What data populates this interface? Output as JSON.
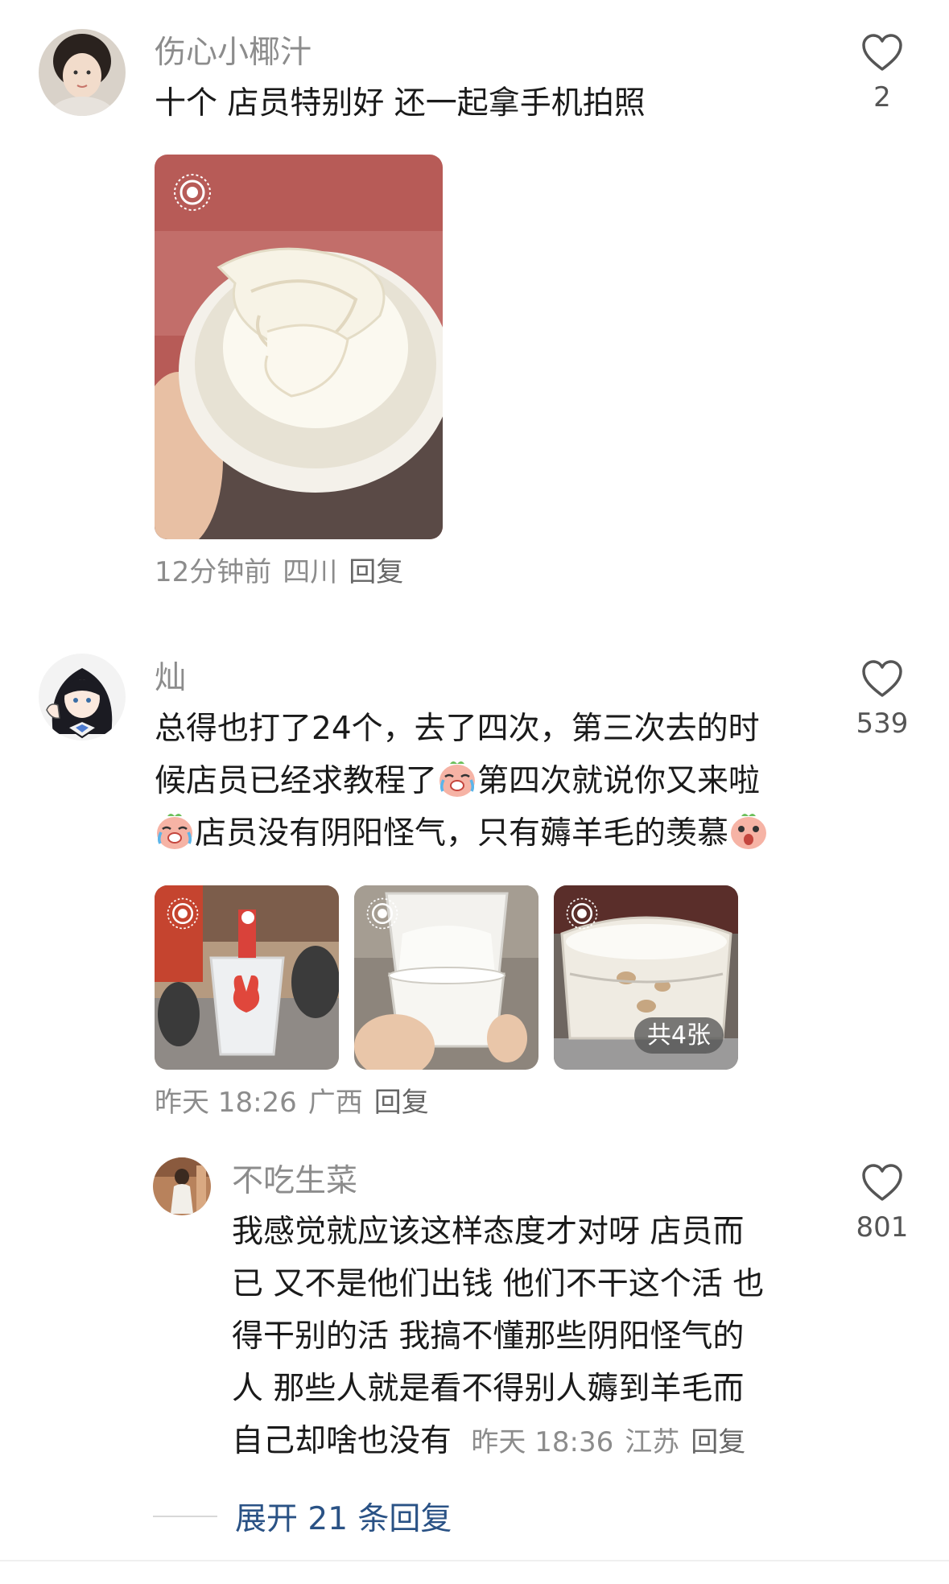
{
  "comments": [
    {
      "username": "伤心小椰汁",
      "text_lines": [
        "十个 店员特别好 还一起拿手机拍照"
      ],
      "likes": "2",
      "time": "12分钟前",
      "location": "四川",
      "reply_label": "回复"
    },
    {
      "username": "灿",
      "line1": "总得也打了24个，去了四次，第三次去的时",
      "line2a": "候店员已经求教程了",
      "line2b": "第四次就说你又来啦",
      "line3": "店员没有阴阳怪气，只有薅羊毛的羡慕",
      "emojis": [
        "crying-laughing-face",
        "crying-laughing-face",
        "shocked-face"
      ],
      "likes": "539",
      "time": "昨天 18:26",
      "location": "广西",
      "reply_label": "回复",
      "photo_count_badge": "共4张"
    }
  ],
  "reply": {
    "username": "不吃生菜",
    "text_lines": [
      "我感觉就应该这样态度才对呀  店员而",
      "已 又不是他们出钱  他们不干这个活 也",
      "得干别的活  我搞不懂那些阴阳怪气的",
      "人  那些人就是看不得别人薅到羊毛而",
      "自己却啥也没有"
    ],
    "likes": "801",
    "time": "昨天 18:36",
    "location": "江苏",
    "reply_label": "回复"
  },
  "expand_replies": "展开 21 条回复",
  "icons": {
    "like": "heart-outline-icon",
    "live_photo": "live-photo-icon"
  },
  "colors": {
    "link": "#2a5285",
    "meta": "#8c8c8c",
    "text": "#1a1a1a"
  }
}
